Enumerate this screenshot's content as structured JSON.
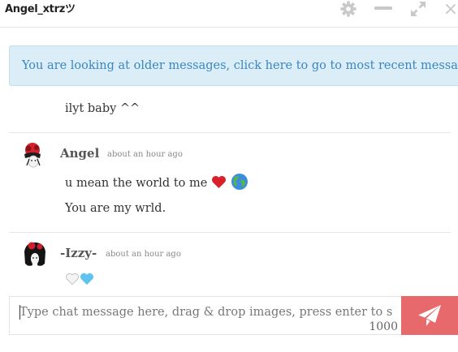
{
  "header": {
    "title": "Angel_xtrzツ",
    "icons": [
      "gear-icon",
      "minimize-icon",
      "expand-icon",
      "close-icon"
    ],
    "close_glyph": "×"
  },
  "notice": {
    "text": "You are looking at older messages, click here to go to most recent message."
  },
  "messages": [
    {
      "lines": [
        "ilyt baby ^^"
      ]
    },
    {
      "author": "Angel",
      "time": "about an hour ago",
      "lines": [
        "u mean the world to me",
        "You are my wrld."
      ],
      "emoji": [
        "red-heart-emoji",
        "globe-emoji"
      ]
    },
    {
      "author": "-Izzy-",
      "time": "about an hour ago",
      "emoji": [
        "white-heart-emoji",
        "blue-heart-emoji"
      ]
    }
  ],
  "composer": {
    "placeholder": "Type chat message here, drag & drop images, press enter to send",
    "counter": "1000",
    "send_icon": "paper-plane-icon"
  },
  "colors": {
    "notice_bg": "#dbeef8",
    "notice_text": "#3a86c2",
    "send_button": "#e8696b",
    "icon_gray": "#c9c9c9"
  }
}
